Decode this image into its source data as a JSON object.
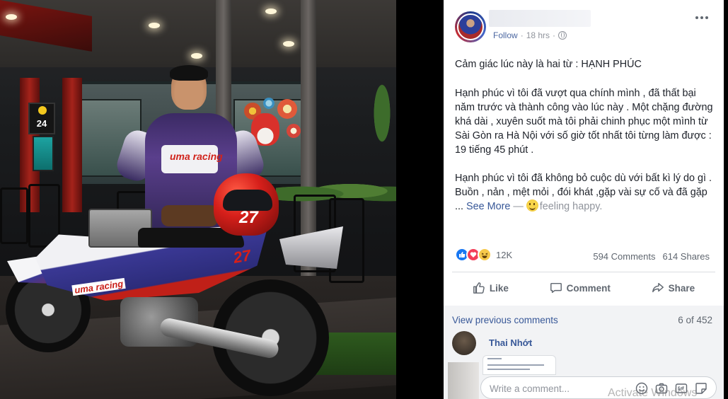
{
  "photo": {
    "alt": "",
    "sign_number": "24",
    "bike_brand_text": "uma racing",
    "helmet_number": "27",
    "bike_number": "27"
  },
  "post": {
    "author_name": "",
    "follow_label": "Follow",
    "time": "18 hrs",
    "separator": "·",
    "text_line1": "Cảm giác lúc này là hai từ : HẠNH PHÚC",
    "text_para2": "Hạnh phúc vì tôi đã vượt qua chính mình , đã thất bại năm trước và thành công vào lúc này . Một chặng đường khá dài , xuyên suốt mà tôi phải chinh phục một mình từ Sài Gòn ra Hà Nội với số giờ tốt nhất tôi từng làm được : 19 tiếng 45 phút .",
    "text_para3": "Hạnh phúc vì tôi đã không bỏ cuộc dù với bất kì lý do gì . Buồn , nản , mệt mỏi , đói khát ,gặp vài sự cố và đã gặp ...",
    "see_more": "See More",
    "dash": "—",
    "feeling": "feeling happy.",
    "reactions_count": "12K",
    "comments_count": "594 Comments",
    "shares_count": "614 Shares",
    "like_label": "Like",
    "comment_label": "Comment",
    "share_label": "Share"
  },
  "comments": {
    "view_previous": "View previous comments",
    "pager": "6 of 452",
    "first_author": "Thai Nhớt",
    "input_placeholder": "Write a comment...",
    "watermark": "Activate Windows"
  },
  "colors": {
    "link": "#385898",
    "like_blue": "#1877f2",
    "love_red": "#f33e58",
    "haha_yellow": "#f7c94b",
    "muted": "#606770"
  },
  "icons": [
    "more-options-icon",
    "globe-icon",
    "like-reaction-icon",
    "love-reaction-icon",
    "haha-reaction-icon",
    "like-icon",
    "comment-icon",
    "share-icon",
    "emoji-icon",
    "camera-icon",
    "gif-icon",
    "sticker-icon",
    "feeling-smiley-icon"
  ]
}
